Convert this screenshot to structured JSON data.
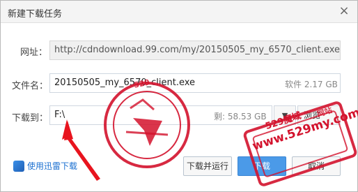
{
  "title": "新建下载任务",
  "close_symbol": "×",
  "url_label": "网址：",
  "url_value": "http://cdndownload.99.com/my/20150505_my_6570_client.exe",
  "filename_label": "文件名：",
  "filename_value": "20150505_my_6570_client.exe",
  "file_meta": "软件 2.17 GB",
  "save_label": "下载到：",
  "save_value": "F:\\",
  "remaining_label": "剩: 58.53 GB",
  "browse_label": "▼",
  "path_button_label": "浏览",
  "thunder_link": "使用迅雷下载",
  "buttons": {
    "run": "下载并运行",
    "download": "下载",
    "cancel": "取消"
  },
  "watermark": {
    "stamp_number": "529",
    "domain": "www.529my.com",
    "site_name": "529魔域",
    "sub": "网站"
  },
  "colors": {
    "stamp": "#d3122c",
    "primary": "#4b9ae8",
    "link": "#1a6fd0"
  }
}
